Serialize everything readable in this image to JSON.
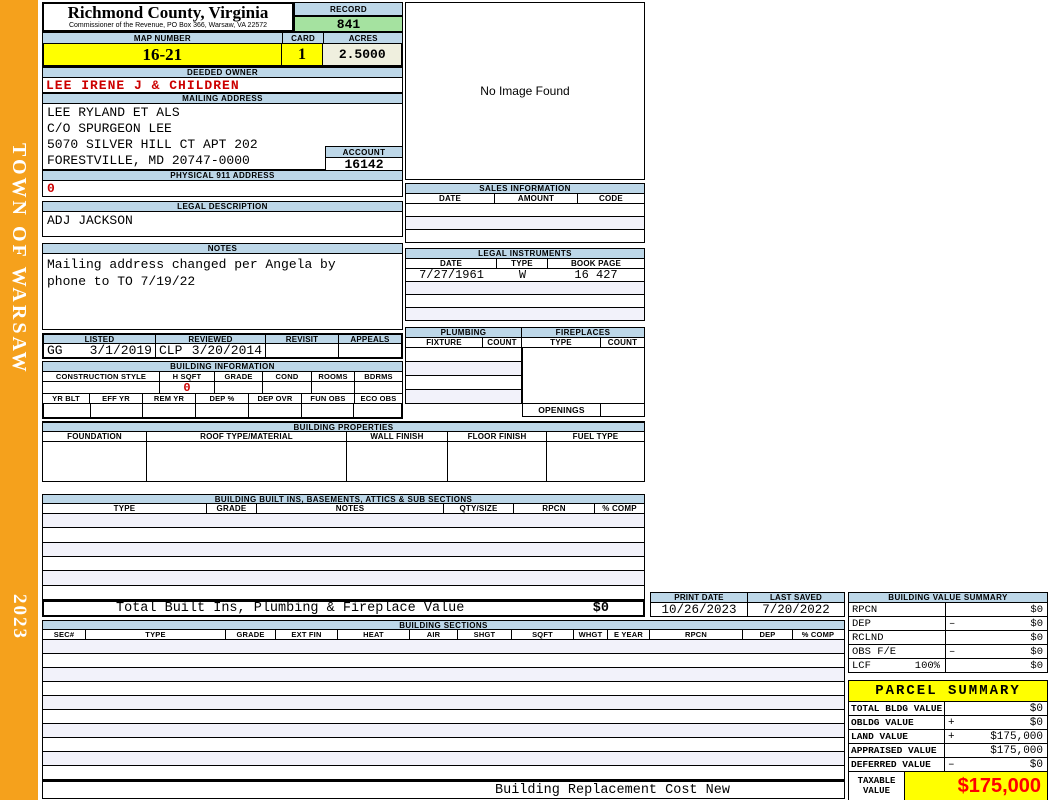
{
  "colors": {
    "sidebar_orange": "#F5A11C",
    "header_blue": "#BDD7E8",
    "record_green": "#A5E2A0",
    "highlight_yellow": "#FFFF00",
    "cream": "#EFEFDE",
    "row_lavender": "#F2F2FA",
    "dark_red": "#CC0000",
    "bright_red": "#FF0000"
  },
  "sidebar": {
    "town": "TOWN OF WARSAW",
    "year": "2023"
  },
  "header": {
    "county": "Richmond County, Virginia",
    "office_line": "Commissioner of the Revenue, PO Box 366, Warsaw, VA 22572",
    "record_label": "RECORD",
    "record_value": "841",
    "map_number_label": "MAP NUMBER",
    "map_number": "16-21",
    "card_label": "CARD",
    "card": "1",
    "acres_label": "ACRES",
    "acres": "2.5000"
  },
  "owner": {
    "deeded_owner_label": "DEEDED OWNER",
    "deeded_owner": "LEE IRENE J & CHILDREN",
    "mailing_address_label": "MAILING ADDRESS",
    "mailing_lines": [
      "LEE RYLAND ET ALS",
      "C/O SPURGEON LEE",
      "5070 SILVER HILL CT APT 202",
      "FORESTVILLE, MD 20747-0000"
    ],
    "account_label": "ACCOUNT",
    "account": "16142",
    "physical_911_label": "PHYSICAL 911 ADDRESS",
    "physical_911": "0"
  },
  "legal": {
    "description_label": "LEGAL DESCRIPTION",
    "description": "ADJ JACKSON",
    "notes_label": "NOTES",
    "notes_lines": [
      "Mailing address changed per Angela by",
      "phone to TO 7/19/22"
    ]
  },
  "image_box": {
    "message": "No Image Found"
  },
  "sales_information": {
    "title": "SALES INFORMATION",
    "headers": [
      "DATE",
      "AMOUNT",
      "CODE"
    ]
  },
  "legal_instruments": {
    "title": "LEGAL INSTRUMENTS",
    "headers": [
      "DATE",
      "TYPE",
      "BOOK PAGE"
    ],
    "rows": [
      {
        "date": "7/27/1961",
        "type": "W",
        "book_page": "16 427"
      }
    ]
  },
  "plumbing": {
    "title": "PLUMBING",
    "headers": [
      "FIXTURE",
      "COUNT"
    ]
  },
  "fireplaces": {
    "title": "FIREPLACES",
    "headers": [
      "TYPE",
      "COUNT"
    ],
    "openings_label": "OPENINGS"
  },
  "review": {
    "listed_label": "LISTED",
    "listed_initials": "GG",
    "listed_date": "3/1/2019",
    "reviewed_label": "REVIEWED",
    "reviewed_initials": "CLP",
    "reviewed_date": "3/20/2014",
    "revisit_label": "REVISIT",
    "appeals_label": "APPEALS"
  },
  "building_information": {
    "title": "BUILDING INFORMATION",
    "row1_headers": [
      "CONSTRUCTION STYLE",
      "H SQFT",
      "GRADE",
      "COND",
      "ROOMS",
      "BDRMS"
    ],
    "h_sqft_value": "0",
    "row2_headers": [
      "YR BLT",
      "EFF YR",
      "REM YR",
      "DEP %",
      "DEP OVR",
      "FUN OBS",
      "ECO OBS"
    ]
  },
  "building_properties": {
    "title": "BUILDING PROPERTIES",
    "headers": [
      "FOUNDATION",
      "ROOF TYPE/MATERIAL",
      "WALL FINISH",
      "FLOOR FINISH",
      "FUEL TYPE"
    ]
  },
  "built_ins": {
    "title": "BUILDING BUILT INS, BASEMENTS, ATTICS & SUB SECTIONS",
    "headers": [
      "TYPE",
      "GRADE",
      "NOTES",
      "QTY/SIZE",
      "RPCN",
      "% COMP"
    ],
    "total_label": "Total Built Ins, Plumbing & Fireplace Value",
    "total_value": "$0"
  },
  "print_info": {
    "print_date_label": "PRINT DATE",
    "print_date": "10/26/2023",
    "last_saved_label": "LAST SAVED",
    "last_saved": "7/20/2022"
  },
  "building_value_summary": {
    "title": "BUILDING VALUE SUMMARY",
    "rows": [
      {
        "label": "RPCN",
        "sign": "",
        "value": "$0"
      },
      {
        "label": "DEP",
        "sign": "–",
        "value": "$0"
      },
      {
        "label": "RCLND",
        "sign": "",
        "value": "$0"
      },
      {
        "label": "OBS F/E",
        "sign": "–",
        "value": "$0"
      },
      {
        "label": "LCF",
        "pct": "100%",
        "sign": "",
        "value": "$0"
      }
    ]
  },
  "building_sections": {
    "title": "BUILDING SECTIONS",
    "headers": [
      "SEC#",
      "TYPE",
      "GRADE",
      "EXT FIN",
      "HEAT",
      "AIR",
      "SHGT",
      "SQFT",
      "WHGT",
      "E YEAR",
      "RPCN",
      "DEP",
      "% COMP"
    ]
  },
  "parcel_summary": {
    "title": "PARCEL SUMMARY",
    "rows": [
      {
        "label": "TOTAL BLDG VALUE",
        "sign": "",
        "value": "$0"
      },
      {
        "label": "OBLDG VALUE",
        "sign": "+",
        "value": "$0"
      },
      {
        "label": "LAND VALUE",
        "sign": "+",
        "value": "$175,000"
      },
      {
        "label": "APPRAISED VALUE",
        "sign": "",
        "value": "$175,000"
      },
      {
        "label": "DEFERRED VALUE",
        "sign": "–",
        "value": "$0"
      }
    ],
    "taxable_label_line1": "TAXABLE",
    "taxable_label_line2": "VALUE",
    "taxable_value": "$175,000"
  },
  "footer": {
    "replacement_cost_label": "Building Replacement Cost New"
  }
}
